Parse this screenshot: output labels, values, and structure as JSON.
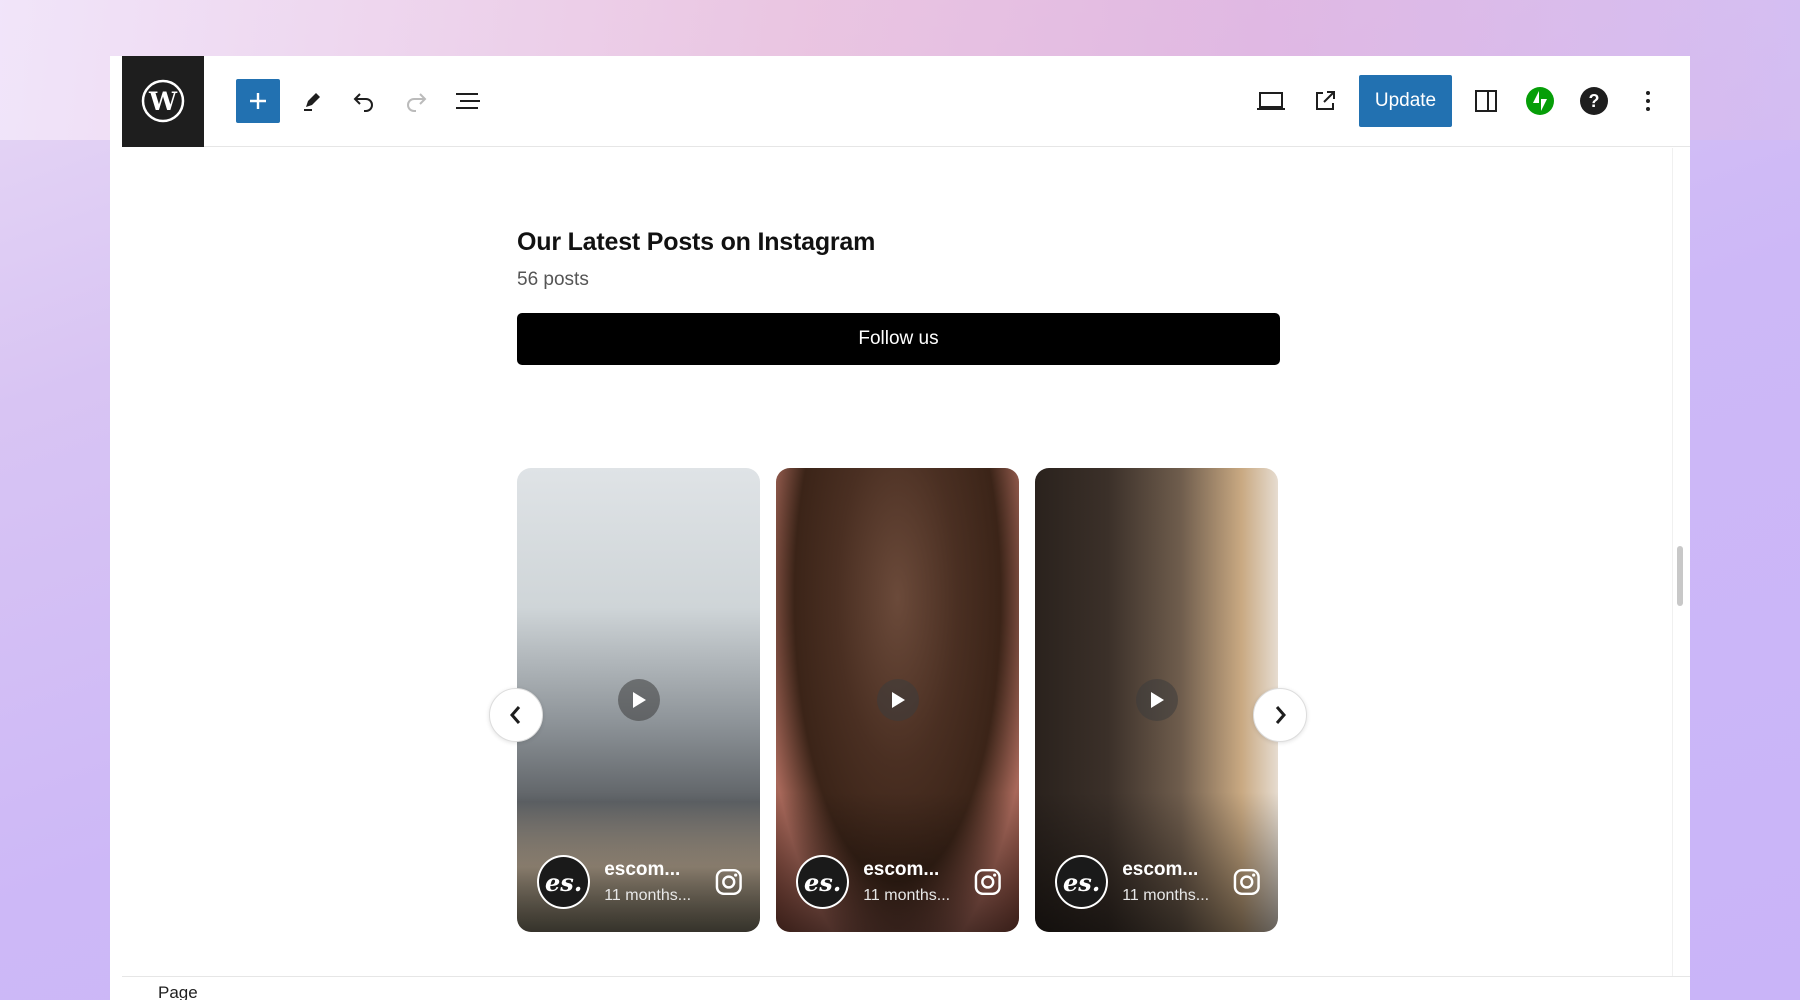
{
  "toolbar": {
    "update_label": "Update",
    "icons": [
      "wordpress-logo-icon",
      "plus-icon",
      "pencil-icon",
      "undo-icon",
      "redo-icon",
      "list-view-icon",
      "desktop-preview-icon",
      "external-link-icon",
      "sidebar-toggle-icon",
      "jetpack-icon",
      "help-icon",
      "more-options-icon"
    ],
    "colors": {
      "accent": "#2271b1",
      "jetpack": "#069e08",
      "logo_bg": "#1e1e1e"
    }
  },
  "feed": {
    "title": "Our Latest Posts on Instagram",
    "post_count": "56 posts",
    "follow_label": "Follow us",
    "cards": [
      {
        "avatar_text": "es.",
        "handle": "escom...",
        "time": "11 months..."
      },
      {
        "avatar_text": "es.",
        "handle": "escom...",
        "time": "11 months..."
      },
      {
        "avatar_text": "es.",
        "handle": "escom...",
        "time": "11 months..."
      }
    ]
  },
  "footer": {
    "breadcrumb": "Page"
  }
}
